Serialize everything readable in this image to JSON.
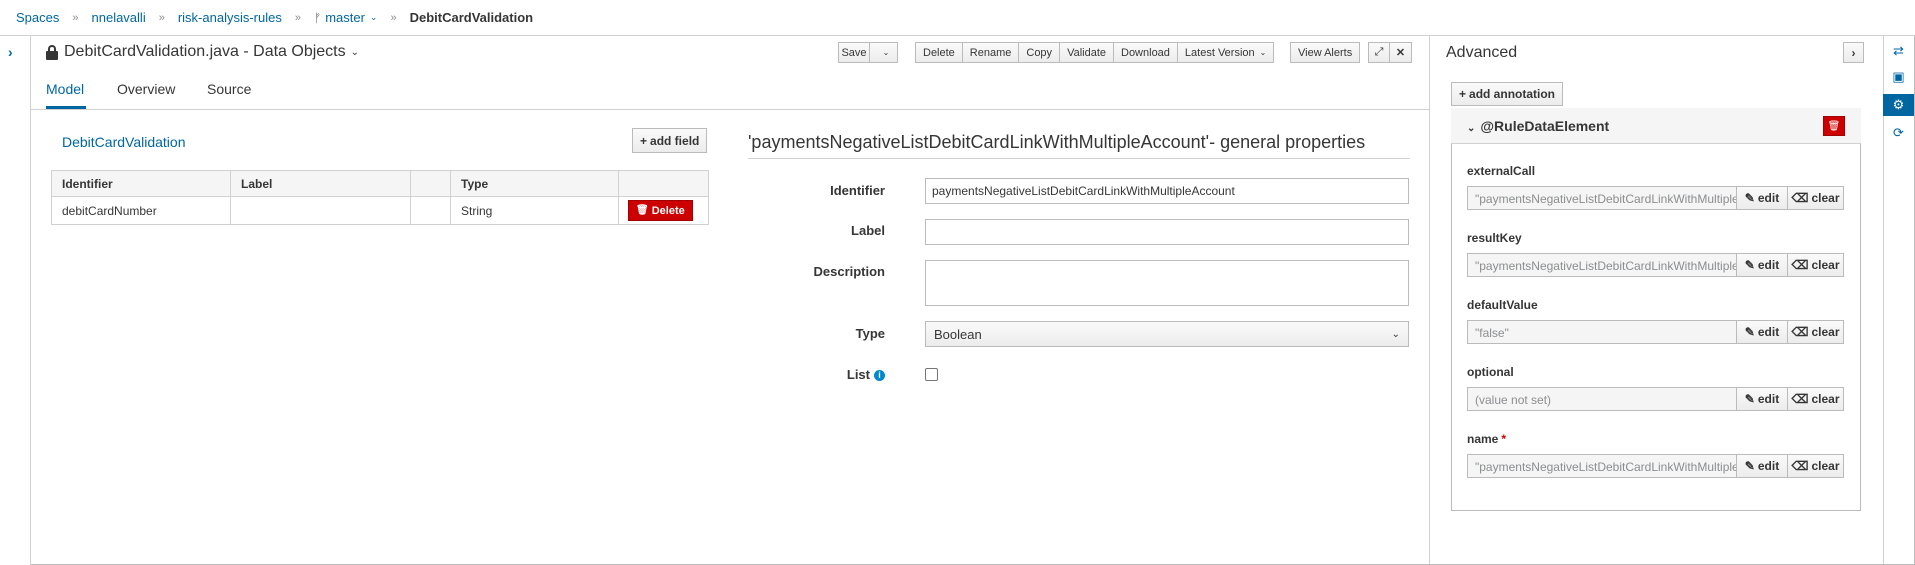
{
  "breadcrumb": {
    "items": [
      "Spaces",
      "nnelavalli",
      "risk-analysis-rules"
    ],
    "branch": "master",
    "current": "DebitCardValidation",
    "separator": "»"
  },
  "editor": {
    "title": "DebitCardValidation.java - Data Objects",
    "toolbar": {
      "save": "Save",
      "delete": "Delete",
      "rename": "Rename",
      "copy": "Copy",
      "validate": "Validate",
      "download": "Download",
      "latest_version": "Latest Version",
      "view_alerts": "View Alerts"
    },
    "tabs": [
      "Model",
      "Overview",
      "Source"
    ],
    "active_tab": "Model"
  },
  "fields": {
    "class_name": "DebitCardValidation",
    "add_field_label": "add field",
    "columns": [
      "Identifier",
      "Label",
      "",
      "Type",
      ""
    ],
    "rows": [
      {
        "identifier": "debitCardNumber",
        "label": "",
        "extra": "",
        "type": "String",
        "action": "Delete"
      }
    ]
  },
  "properties": {
    "title": "'paymentsNegativeListDebitCardLinkWithMultipleAccount'- general properties",
    "identifier_label": "Identifier",
    "identifier_value": "paymentsNegativeListDebitCardLinkWithMultipleAccount",
    "label_label": "Label",
    "label_value": "",
    "description_label": "Description",
    "description_value": "",
    "type_label": "Type",
    "type_value": "Boolean",
    "list_label": "List",
    "list_checked": false
  },
  "advanced": {
    "title": "Advanced",
    "add_annotation_label": "add annotation",
    "annotation_name": "@RuleDataElement",
    "edit_label": "edit",
    "clear_label": "clear",
    "attributes": [
      {
        "name": "externalCall",
        "value": "\"paymentsNegativeListDebitCardLinkWithMultipleAccount\"",
        "required": false
      },
      {
        "name": "resultKey",
        "value": "\"paymentsNegativeListDebitCardLinkWithMultipleAccount\"",
        "required": false
      },
      {
        "name": "defaultValue",
        "value": "\"false\"",
        "required": false
      },
      {
        "name": "optional",
        "value": "(value not set)",
        "required": false
      },
      {
        "name": "name",
        "value": "\"paymentsNegativeListDebitCardLinkWithMultipleAccount\"",
        "required": true
      }
    ],
    "required_marker": "*"
  },
  "right_rail": {
    "icons": [
      "shuffle-icon",
      "briefcase-icon",
      "gear-icon",
      "refresh-icon"
    ],
    "active_icon": "gear-icon"
  },
  "colors": {
    "link": "#0066a1",
    "danger": "#cc0000",
    "border": "#d1d1d1"
  }
}
